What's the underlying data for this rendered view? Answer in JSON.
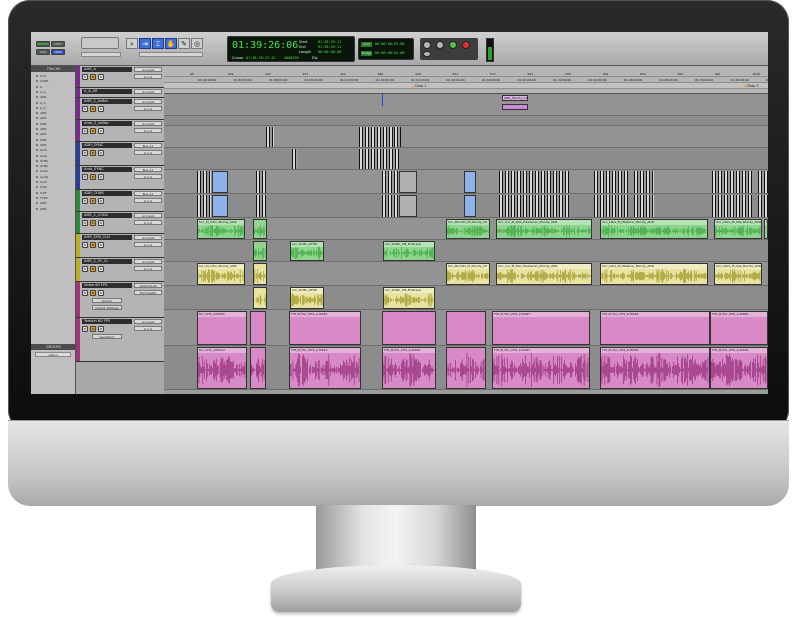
{
  "toolbar": {
    "mode_buttons": [
      "SHUFFLE",
      "SPOT",
      "SLIP",
      "GRID"
    ],
    "main_counter": "01:39:26:06",
    "cursor_label": "Cursor",
    "cursor_value": "01:38:28:23.32",
    "start_label": "Start",
    "end_label": "End",
    "length_label": "Length",
    "start_value": "01:38:49:11",
    "end_value": "01:38:49:11",
    "length_value": "00:00:00:00",
    "sample_value": "4008709",
    "dly_label": "Dly",
    "grid_label": "Grid",
    "grid_value": "00:00:00:01.00",
    "nudge_label": "Nudge",
    "nudge_value": "00:00:00:01.00"
  },
  "left_panel": {
    "tracks_header": "TRACKS",
    "groups_header": "GROUPS",
    "all_group": "<ALL>",
    "track_list": [
      "CUT",
      "CONT",
      "A",
      "A_A",
      "ADR",
      "A_A",
      "A_S",
      "ADR",
      "ADR",
      "ADR",
      "ADR",
      "ADR",
      "ADR",
      "ADR",
      "Amb",
      "Amb",
      "SYNC",
      "SYNC",
      "AudC",
      "AudG",
      "Audi",
      "VidV",
      "VidF",
      "TSSP",
      "ADR",
      "ADR"
    ]
  },
  "ruler": {
    "rows": [
      "Bars|Beats",
      "Timecode",
      "Markers"
    ],
    "bar_ticks": [
      "65",
      "129",
      "193",
      "257",
      "321",
      "385",
      "449",
      "513",
      "577",
      "641",
      "705",
      "769",
      "833",
      "897",
      "961",
      "1025"
    ],
    "timecode_ticks": [
      "01:02:00:00",
      "01:04:00:00",
      "01:06:00:00",
      "01:08:00:00",
      "01:10:00:00",
      "01:12:00:00",
      "01:14:00:00",
      "01:16:00:00",
      "01:18:00:00",
      "01:20:00:00",
      "01:22:00:00",
      "01:24:00:00",
      "01:26:00:00",
      "01:28:00:00",
      "01:30:00:00",
      "01:32:00:00",
      "01:34:00:00"
    ],
    "markers": [
      "Chap 2",
      "Chap 3"
    ]
  },
  "tracks": [
    {
      "name": "ADR_A",
      "color": "#7a2a8a",
      "io": [
        "no input",
        "A 1-2"
      ],
      "height": 22
    },
    {
      "name": "A_A_AR",
      "color": "#7a2a8a",
      "io": [
        "no input",
        "A 1-2"
      ],
      "height": 10
    },
    {
      "name": "ADR_2_AsRec",
      "color": "#7a2a8a",
      "io": [
        "no input",
        "A 1-2"
      ],
      "height": 22
    },
    {
      "name": "Amb_2_AsRec",
      "color": "#7a2a8a",
      "io": [
        "no input",
        "A 1-2"
      ],
      "height": 22
    },
    {
      "name": "ADR_SYNC",
      "color": "#2d3b9c",
      "io": [
        "Bus 11",
        "A 1-2"
      ],
      "height": 24
    },
    {
      "name": "Amb_SYNC",
      "color": "#2d3b9c",
      "io": [
        "Bus 11",
        "A 1-2"
      ],
      "height": 24
    },
    {
      "name": "ADR_CONS",
      "color": "#2e8a3a",
      "io": [
        "Bus 11",
        "A 1-2"
      ],
      "height": 22
    },
    {
      "name": "ADR_2_CONS",
      "color": "#2e8a3a",
      "io": [
        "no input",
        "A 1-2"
      ],
      "height": 22
    },
    {
      "name": "ADR_SYN_CLN",
      "color": "#b8b020",
      "io": [
        "no input",
        "A 1-2"
      ],
      "height": 24
    },
    {
      "name": "ADR_2_SY_CL",
      "color": "#b8b020",
      "io": [
        "no input",
        "A 1-2"
      ],
      "height": 24
    },
    {
      "name": "Video 60 FPS",
      "color": "#a2327a",
      "io": [
        "120p/59.94",
        "Full Quality"
      ],
      "extra": [
        "blocks",
        "Output Settings"
      ],
      "height": 36
    },
    {
      "name": "Temoin 60 FPS",
      "color": "#a2327a",
      "io": [
        "no input",
        "A 1-2"
      ],
      "extra": [
        "waveform"
      ],
      "height": 44
    }
  ],
  "lane_labels": {
    "clip_names": [
      "ADR_Mundy_C1",
      "ADR_Mundy_C1",
      "Scn_BornRn_M_Mundy_C2",
      "Scn_Cor_M_Kiss_Headscan_Mundy_ADR",
      "Scn_Libre_M_Webinar_Mundy_ADR",
      "Scn_Libre_M_Idle_Mundy_ADR",
      "TraRi_Main",
      "Scn_M_Intro_Mundy_ADR",
      "scn_DrrBn_OF08",
      "scn_DrrBn_SM_Embrace",
      "Fac_CH1_scl0001",
      "TIH_M_Fac_CH1_scl0019",
      "TIH_M_Fac_CH1_scl0027",
      "TIH_M_Fac_CH2_scl0034",
      "TIH_M_Fac_CH2_scl0040",
      "Fac_CH1_scl0012",
      "TIH_M_Fac_CH1_scl0013",
      "TIH_M_Fac_CH1_scl0015",
      "TIH_M_Fac_CH2_scl0029"
    ]
  },
  "colors": {
    "green_clip": "#8fd48f",
    "yellow_clip": "#e8e3a1",
    "pink_clip": "#d88ac7",
    "wave_green": "#2f9f2f",
    "wave_yellow": "#8f8a10",
    "wave_pink": "#8a1e6c",
    "blue_clip": "#8fb2e8"
  },
  "icons": [
    "zoom-icon",
    "trim-icon",
    "select-icon",
    "grabber-icon",
    "pencil-icon",
    "smart-tool-icon",
    "rewind-icon",
    "forward-icon",
    "stop-icon",
    "play-icon",
    "record-icon"
  ]
}
